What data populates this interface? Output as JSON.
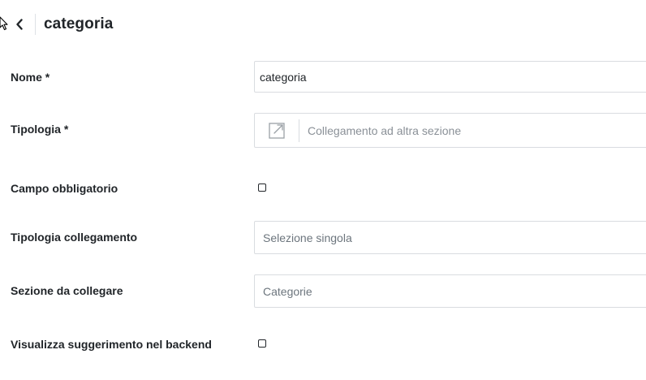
{
  "header": {
    "title": "categoria"
  },
  "form": {
    "nome": {
      "label": "Nome *",
      "value": "categoria"
    },
    "tipologia": {
      "label": "Tipologia *",
      "value": "Collegamento ad altra sezione",
      "icon": "external-link-icon"
    },
    "campo_obbligatorio": {
      "label": "Campo obbligatorio",
      "checked": false
    },
    "tipologia_collegamento": {
      "label": "Tipologia collegamento",
      "value": "Selezione singola"
    },
    "sezione_da_collegare": {
      "label": "Sezione da collegare",
      "value": "Categorie"
    },
    "visualizza_suggerimento": {
      "label": "Visualizza suggerimento nel backend",
      "checked": false
    }
  }
}
